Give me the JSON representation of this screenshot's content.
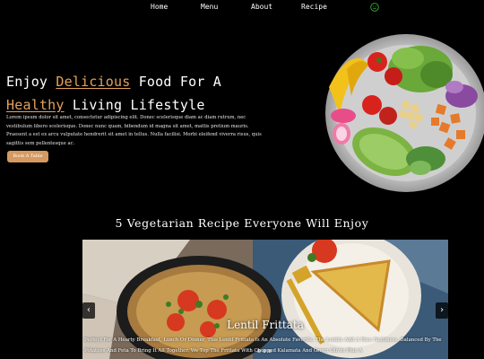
{
  "nav": {
    "items": [
      {
        "label": "Home"
      },
      {
        "label": "Menu"
      },
      {
        "label": "About"
      },
      {
        "label": "Recipe"
      }
    ],
    "icon": "smile-icon"
  },
  "hero": {
    "title_line1_pre": "Enjoy ",
    "title_line1_hl": "Delicious",
    "title_line1_post": " Food For A",
    "title_line2_hl": "Healthy",
    "title_line2_post": " Living Lifestyle",
    "description": "Lorem ipsum dolor sit amet, consectetur adipiscing elit. Donec scelerisque diam ac diam rutrum, nec vestibulum libero scelerisque. Donec nunc quam, bibendum id magna sit amet, mattis pretium mauris. Praesent a est ex arcu vulputate hendrerit sit amet in tellus. Nulla facilisi. Morbi eleifend viverra risus, quis sagittis sem pellentesque ac.",
    "button_label": "Book A Table",
    "accent_color": "#e6a15c",
    "image_icon": "salad-bowl-image"
  },
  "recipes": {
    "section_title": "5 Vegetarian Recipe Everyone Will Enjoy",
    "slide": {
      "title": "Lentil Frittata",
      "text": "Perfect For A Hearty Breakfast, Lunch Or Dinner, This Lentil Frittata Is An Absolute Favorite. The Lentils Add A Nice Nuttiness, Balanced By The Potatoes And Feta To Bring It All Together. We Top The Frittata With Chopped Kalamata And Green Olives Plus A"
    },
    "prev_icon": "‹",
    "next_icon": "›"
  }
}
